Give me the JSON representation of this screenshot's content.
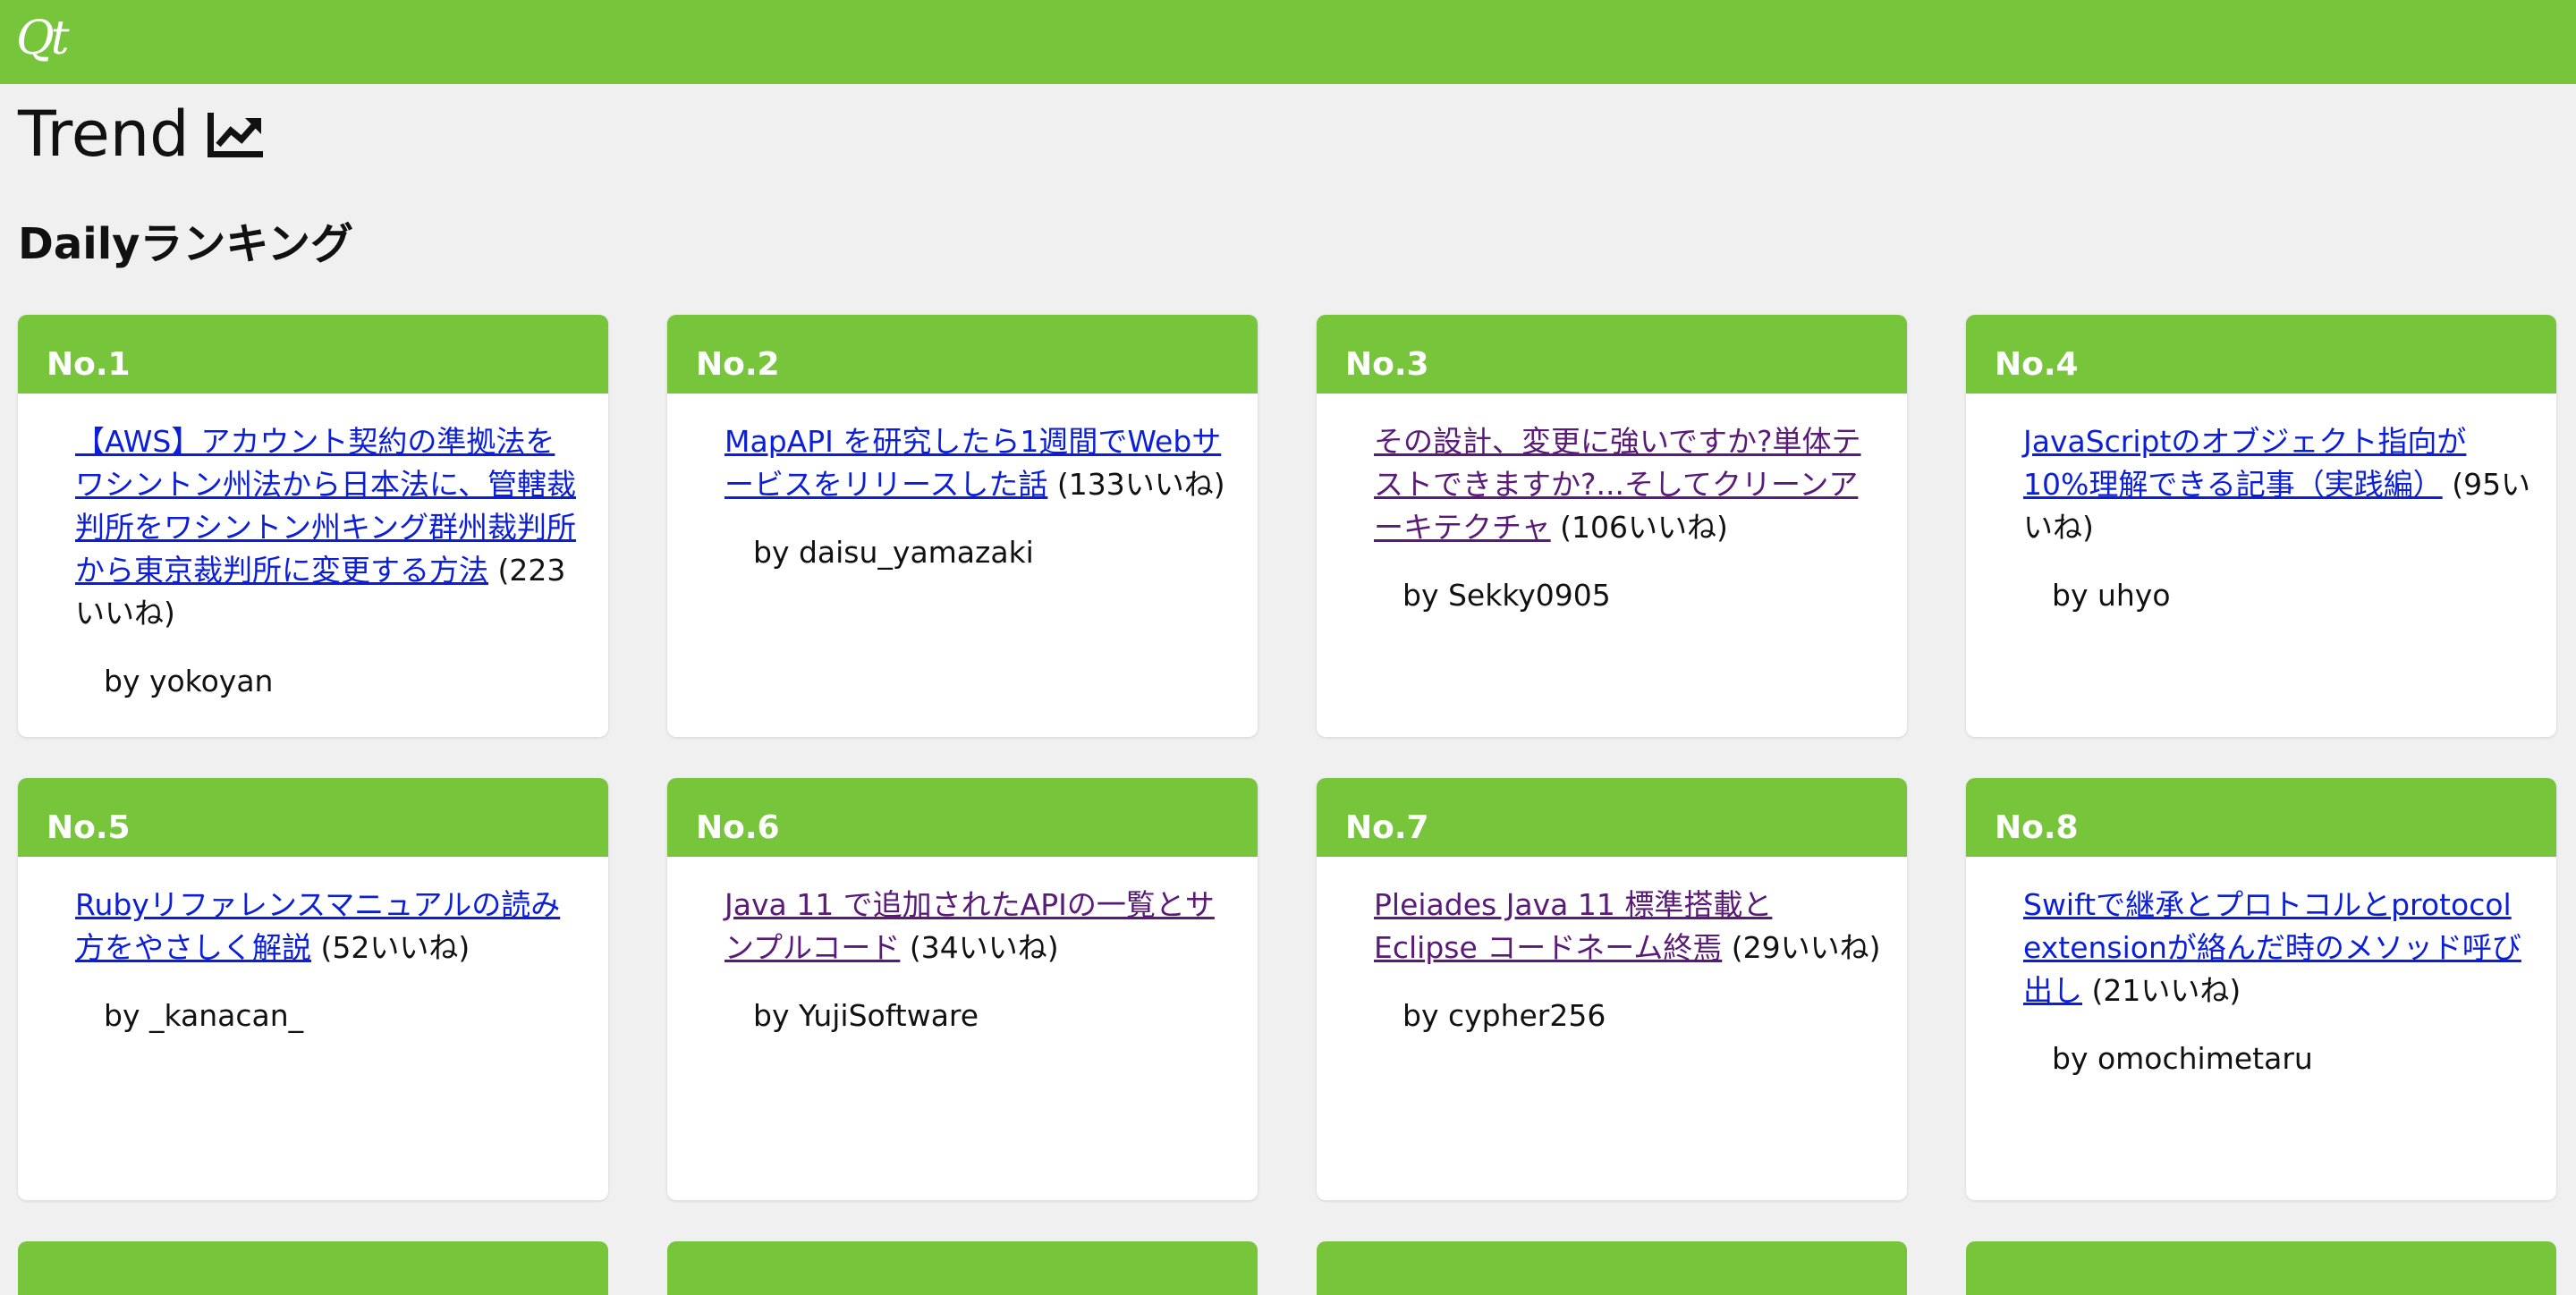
{
  "navbar": {
    "logo_text": "Qt",
    "color": "#76c53b"
  },
  "page": {
    "title": "Trend",
    "title_icon": "chart-line-icon"
  },
  "section": {
    "title": "Dailyランキング"
  },
  "cards": [
    {
      "rank": "No.1",
      "title": "【AWS】アカウント契約の準拠法をワシントン州法から日本法に、管轄裁判所をワシントン州キング群州裁判所から東京裁判所に変更する方法",
      "likes": " (223いいね)",
      "author": "by yokoyan",
      "visited": false
    },
    {
      "rank": "No.2",
      "title": "MapAPI を研究したら1週間でWebサービスをリリースした話",
      "likes": " (133いいね)",
      "author": "by daisu_yamazaki",
      "visited": false
    },
    {
      "rank": "No.3",
      "title": "その設計、変更に強いですか?単体テストできますか?...そしてクリーンアーキテクチャ",
      "likes": " (106いいね)",
      "author": "by Sekky0905",
      "visited": true
    },
    {
      "rank": "No.4",
      "title": "JavaScriptのオブジェクト指向が10%理解できる記事（実践編）",
      "likes": " (95いいね)",
      "author": "by uhyo",
      "visited": false
    },
    {
      "rank": "No.5",
      "title": "Rubyリファレンスマニュアルの読み方をやさしく解説",
      "likes": " (52いいね)",
      "author": "by _kanacan_",
      "visited": false
    },
    {
      "rank": "No.6",
      "title": "Java 11 で追加されたAPIの一覧とサンプルコード",
      "likes": " (34いいね)",
      "author": "by YujiSoftware",
      "visited": true
    },
    {
      "rank": "No.7",
      "title": "Pleiades Java 11 標準搭載と Eclipse コードネーム終焉",
      "likes": " (29いいね)",
      "author": "by cypher256",
      "visited": true
    },
    {
      "rank": "No.8",
      "title": "Swiftで継承とプロトコルとprotocol extensionが絡んだ時のメソッド呼び出し",
      "likes": " (21いいね)",
      "author": "by omochimetaru",
      "visited": false
    }
  ],
  "colors": {
    "accent": "#76c53b",
    "link": "#0b1ed8",
    "visited_link": "#5a1a78",
    "background": "#f0f0f0"
  }
}
